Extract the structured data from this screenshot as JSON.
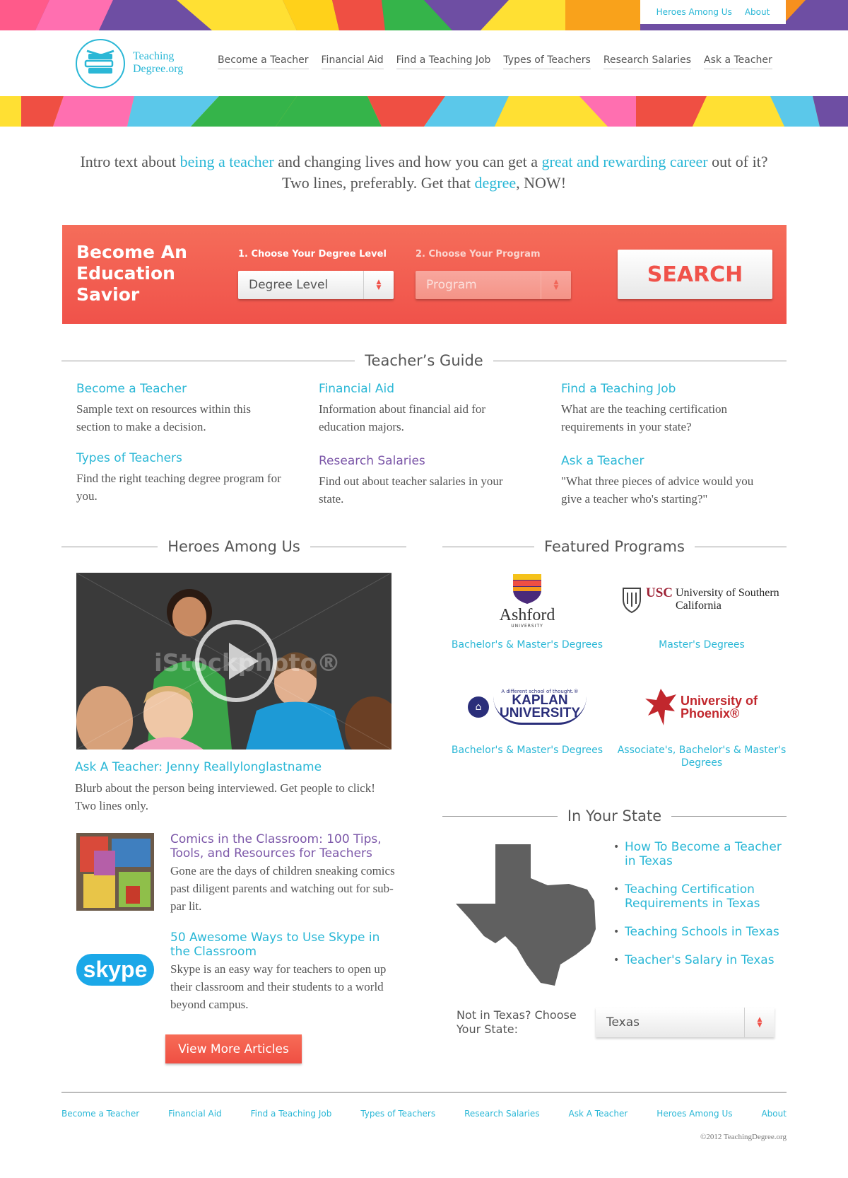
{
  "top_links": [
    "Heroes Among Us",
    "About"
  ],
  "logo": {
    "line1": "Teaching",
    "line2": "Degree.org"
  },
  "nav": [
    "Become a Teacher",
    "Financial Aid",
    "Find a Teaching Job",
    "Types of Teachers",
    "Research Salaries",
    "Ask a Teacher"
  ],
  "intro": {
    "p1": "Intro text about ",
    "l1": "being a teacher",
    "p2": " and changing lives and how you can get a ",
    "l2": "great and rewarding career",
    "p3": " out of it? Two lines, preferably. Get that ",
    "l3": "degree",
    "p4": ", NOW!"
  },
  "search": {
    "title": "Become An Education Savior",
    "label1": "1. Choose Your Degree Level",
    "select1": "Degree Level",
    "label2": "2. Choose Your Program",
    "select2": "Program",
    "button": "SEARCH"
  },
  "guide": {
    "heading": "Teacher’s Guide",
    "items": [
      {
        "title": "Become a Teacher",
        "desc": "Sample text on resources within this section to make a decision."
      },
      {
        "title": "Financial Aid",
        "desc": "Information about financial aid for education majors."
      },
      {
        "title": "Find a Teaching Job",
        "desc": "What are the teaching certification requirements in your state?"
      },
      {
        "title": "Types of Teachers",
        "desc": "Find the right teaching degree program for you."
      },
      {
        "title": "Research Salaries",
        "desc": "Find out about teacher salaries in your state."
      },
      {
        "title": "Ask a Teacher",
        "desc": "\"What three pieces of advice would you give a teacher who's starting?\""
      }
    ]
  },
  "heroes": {
    "heading": "Heroes Among Us",
    "video_caption": "Ask A Teacher: Jenny Reallylonglastname",
    "video_blurb": "Blurb about the person being interviewed. Get people to click! Two lines only.",
    "watermark": "iStockphoto®",
    "articles": [
      {
        "title": "Comics in the Classroom: 100 Tips, Tools, and Resources for Teachers",
        "desc": "Gone are the days of children sneaking comics past diligent parents and watching out for sub-par lit."
      },
      {
        "title": "50 Awesome Ways to Use Skype in the Classroom",
        "desc": "Skype is an easy way for teachers to open up their classroom and their students to a world beyond campus."
      }
    ],
    "view_more": "View More Articles"
  },
  "programs": {
    "heading": "Featured Programs",
    "items": [
      {
        "logo_text": "Ashford",
        "logo_sub": "UNIVERSITY",
        "caption": "Bachelor's & Master's Degrees"
      },
      {
        "logo_text": "USC",
        "logo_sub": "University of Southern California",
        "caption": "Master's Degrees"
      },
      {
        "logo_text": "KAPLAN UNIVERSITY",
        "logo_sub": "A different school of thought.®",
        "caption": "Bachelor's & Master's Degrees"
      },
      {
        "logo_text": "University of Phoenix®",
        "logo_sub": "",
        "caption": "Associate's, Bachelor's & Master's Degrees"
      }
    ]
  },
  "state": {
    "heading": "In Your State",
    "links": [
      "How To Become a Teacher in Texas",
      "Teaching Certification Requirements in Texas",
      "Teaching Schools in Texas",
      "Teacher's Salary in Texas"
    ],
    "prompt": "Not in Texas? Choose Your State:",
    "selected": "Texas"
  },
  "skype_logo": "skype",
  "footer": {
    "links": [
      "Become a Teacher",
      "Financial Aid",
      "Find a Teaching Job",
      "Types of Teachers",
      "Research Salaries",
      "Ask A Teacher",
      "Heroes Among Us",
      "About"
    ],
    "copyright": "©2012 TeachingDegree.org"
  },
  "colors": {
    "accent": "#2ab7d6",
    "cta": "#f0524a",
    "visited": "#7b56a8"
  }
}
